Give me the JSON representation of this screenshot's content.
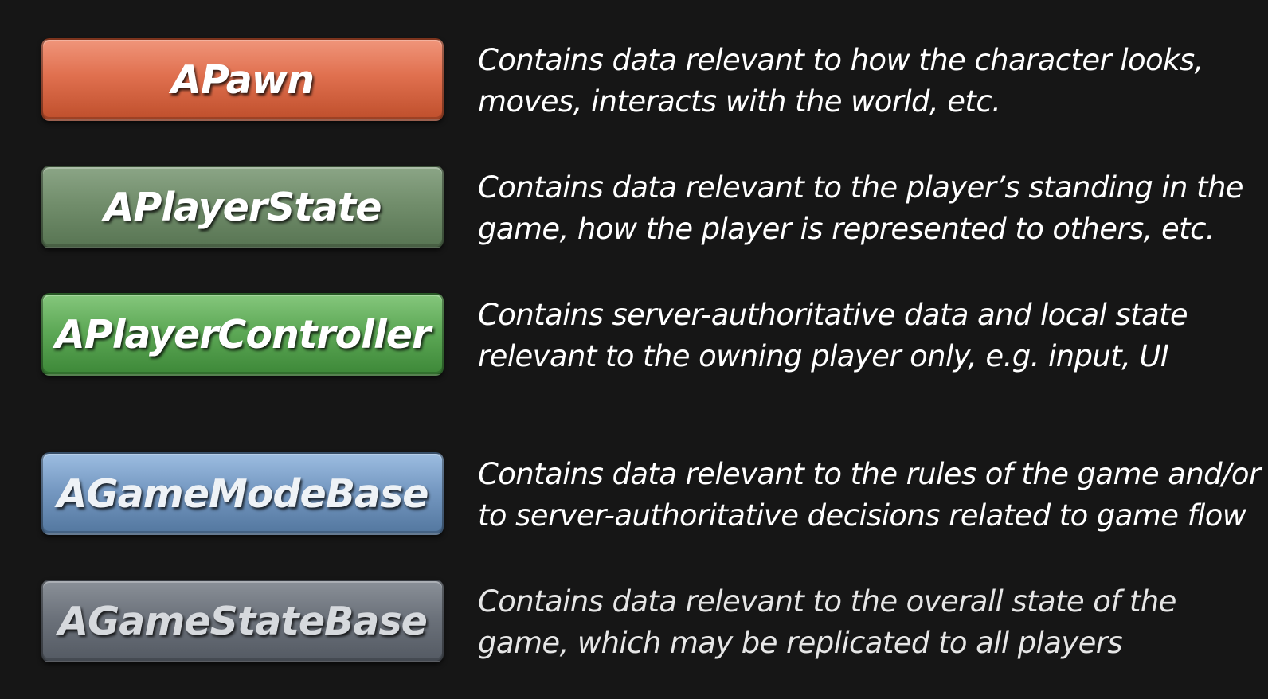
{
  "items": [
    {
      "label": "APawn",
      "color": "#e0704f",
      "description": [
        "Contains data relevant to how the character looks,",
        "moves, interacts with the world, etc."
      ]
    },
    {
      "label": "APlayerState",
      "color": "#728e6c",
      "description": [
        "Contains data relevant to the player’s standing in the",
        "game, how the player is represented to others, etc."
      ]
    },
    {
      "label": "APlayerController",
      "color": "#5ea957",
      "description": [
        "Contains server-authoritative data and local state",
        "relevant to the owning player only, e.g. input, UI"
      ]
    },
    {
      "label": "AGameModeBase",
      "color": "#7699c2",
      "description": [
        "Contains data relevant to the rules of the game and/or",
        "to server-authoritative decisions related to game flow"
      ]
    },
    {
      "label": "AGameStateBase",
      "color": "#6c727b",
      "description": [
        "Contains data relevant to the overall state of the",
        "game, which may be replicated to all players"
      ]
    }
  ]
}
